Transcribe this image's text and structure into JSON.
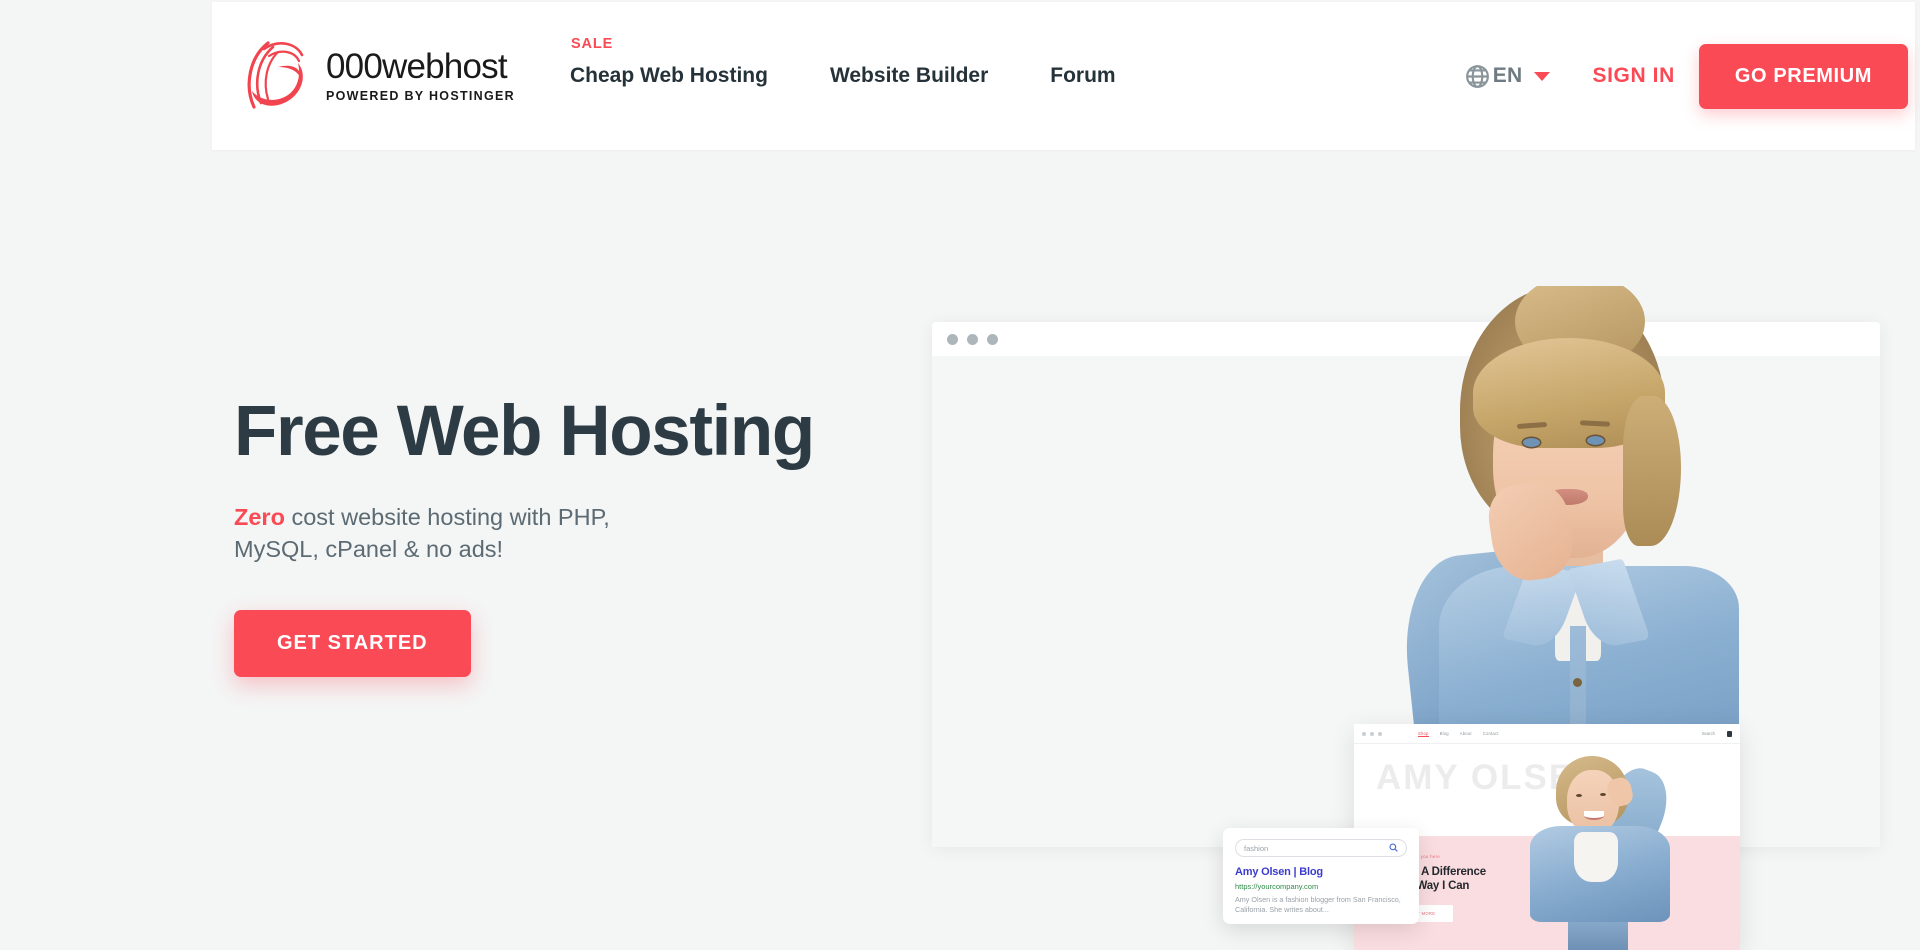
{
  "brand": {
    "name": "000webhost",
    "tagline": "POWERED BY HOSTINGER",
    "logo_icon": "swirl-logo-icon",
    "accent_color": "#fa4a56"
  },
  "header": {
    "nav": [
      {
        "label": "Cheap Web Hosting",
        "badge": "SALE"
      },
      {
        "label": "Website Builder",
        "badge": ""
      },
      {
        "label": "Forum",
        "badge": ""
      }
    ],
    "language": {
      "icon": "globe-icon",
      "code": "EN",
      "caret_icon": "chevron-down-icon"
    },
    "sign_in_label": "SIGN IN",
    "premium_label": "GO PREMIUM"
  },
  "hero": {
    "title": "Free Web Hosting",
    "subtitle_highlight": "Zero",
    "subtitle_rest": " cost website hosting with PHP, MySQL, cPanel & no ads!",
    "cta_label": "GET STARTED"
  },
  "browser_mock": {
    "dots": [
      "dot",
      "dot",
      "dot"
    ]
  },
  "inner_site": {
    "nav": [
      "Shop",
      "Blog",
      "About",
      "Contact"
    ],
    "search_label": "Search",
    "cart_icon": "cart-icon",
    "watermark": "AMY OLSEN",
    "eyebrow": "Hi, its nice to see you here",
    "heading_line1": "Making A Difference",
    "heading_line2": "In Any Way I Can",
    "button_label": "FIND OUT MORE"
  },
  "search_card": {
    "query_placeholder": "fashion",
    "search_icon": "magnifier-icon",
    "result_title": "Amy Olsen | Blog",
    "result_url": "https://yourcompany.com",
    "result_desc": "Amy Olsen is a fashion blogger from San Francisco, California. She writes about..."
  }
}
